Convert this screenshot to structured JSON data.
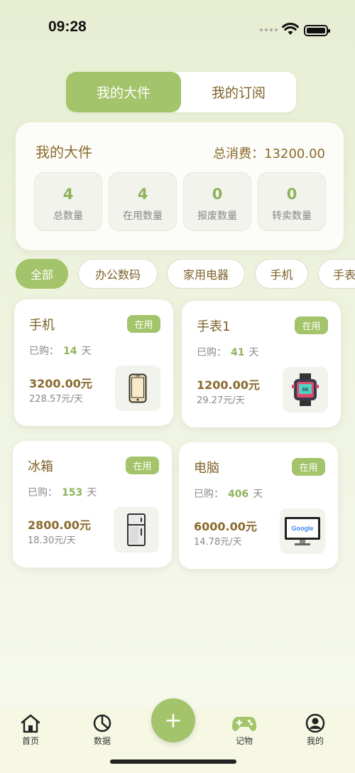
{
  "status": {
    "time": "09:28"
  },
  "segment": {
    "tabs": [
      "我的大件",
      "我的订阅"
    ],
    "active": 0
  },
  "summary": {
    "title": "我的大件",
    "total_label": "总消费：",
    "total_value": "13200.00",
    "stats": [
      {
        "value": "4",
        "label": "总数量"
      },
      {
        "value": "4",
        "label": "在用数量"
      },
      {
        "value": "0",
        "label": "报废数量"
      },
      {
        "value": "0",
        "label": "转卖数量"
      }
    ]
  },
  "filters": [
    "全部",
    "办公数码",
    "家用电器",
    "手机",
    "手表"
  ],
  "items": [
    {
      "name": "手机",
      "status": "在用",
      "bought_label": "已购：",
      "days": "14",
      "days_unit": "天",
      "price": "3200.00元",
      "daily": "228.57元/天",
      "icon": "phone-icon"
    },
    {
      "name": "手表1",
      "status": "在用",
      "bought_label": "已购：",
      "days": "41",
      "days_unit": "天",
      "price": "1200.00元",
      "daily": "29.27元/天",
      "icon": "watch-icon"
    },
    {
      "name": "冰箱",
      "status": "在用",
      "bought_label": "已购：",
      "days": "153",
      "days_unit": "天",
      "price": "2800.00元",
      "daily": "18.30元/天",
      "icon": "fridge-icon"
    },
    {
      "name": "电脑",
      "status": "在用",
      "bought_label": "已购：",
      "days": "406",
      "days_unit": "天",
      "price": "6000.00元",
      "daily": "14.78元/天",
      "icon": "computer-icon",
      "screen_text": "Google"
    }
  ],
  "tabbar": {
    "items": [
      {
        "label": "首页",
        "icon": "home-icon"
      },
      {
        "label": "数据",
        "icon": "chart-pie-icon"
      },
      {
        "label": "记物",
        "icon": "gamepad-icon"
      },
      {
        "label": "我的",
        "icon": "user-icon"
      }
    ],
    "fab_label": "+"
  },
  "colors": {
    "accent": "#a3c46a",
    "text_brown": "#8a6a2e",
    "number_green": "#8fb35c"
  }
}
